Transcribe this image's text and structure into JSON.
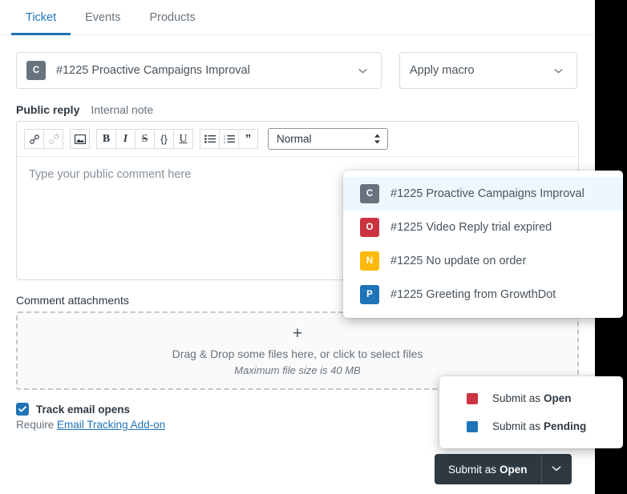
{
  "tabs": [
    {
      "label": "Ticket",
      "active": true
    },
    {
      "label": "Events",
      "active": false
    },
    {
      "label": "Products",
      "active": false
    }
  ],
  "ticket_select": {
    "badge_letter": "C",
    "badge_color": "#68737d",
    "label": "#1225 Proactive Campaigns Improval"
  },
  "macro_select": {
    "label": "Apply macro"
  },
  "reply_tabs": [
    {
      "label": "Public reply",
      "active": true
    },
    {
      "label": "Internal note",
      "active": false
    }
  ],
  "toolbar": {
    "link_icon": "link-icon",
    "unlink_icon": "unlink-icon",
    "image_icon": "image-icon",
    "bold_label": "B",
    "italic_label": "I",
    "strike_label": "S",
    "code_label": "{}",
    "underline_label": "U",
    "bullet_list_icon": "bullet-list-icon",
    "numbered_list_icon": "numbered-list-icon",
    "quote_label": "”",
    "format_value": "Normal"
  },
  "editor": {
    "placeholder": "Type your public comment here"
  },
  "attachments": {
    "label": "Comment attachments",
    "plus": "+",
    "drop_text": "Drag & Drop some files here, or click to select files",
    "max_size_text": "Maximum file size is 40 MB"
  },
  "track_email": {
    "checked": true,
    "label": "Track email opens",
    "require_prefix": "Require",
    "link_label": "Email Tracking Add-on"
  },
  "submit": {
    "prefix": "Submit as",
    "status": "Open",
    "caret_icon": "chevron-down-icon"
  },
  "ticket_menu": {
    "items": [
      {
        "badge_letter": "C",
        "badge_color": "#68737d",
        "label": "#1225 Proactive Campaigns Improval",
        "highlighted": true
      },
      {
        "badge_letter": "O",
        "badge_color": "#cc3340",
        "label": "#1225 Video Reply trial expired",
        "highlighted": false
      },
      {
        "badge_letter": "N",
        "badge_color": "#ffb908",
        "label": "#1225 No update on order",
        "highlighted": false
      },
      {
        "badge_letter": "P",
        "badge_color": "#1f73b7",
        "label": "#1225 Greeting from GrowthDot",
        "highlighted": false
      }
    ]
  },
  "submit_menu": {
    "items": [
      {
        "prefix": "Submit as",
        "status": "Open",
        "color": "#cc3340"
      },
      {
        "prefix": "Submit as",
        "status": "Pending",
        "color": "#1f73b7"
      }
    ]
  },
  "colors": {
    "accent": "#1f73b7",
    "dark": "#2f3941",
    "muted": "#68737d"
  }
}
